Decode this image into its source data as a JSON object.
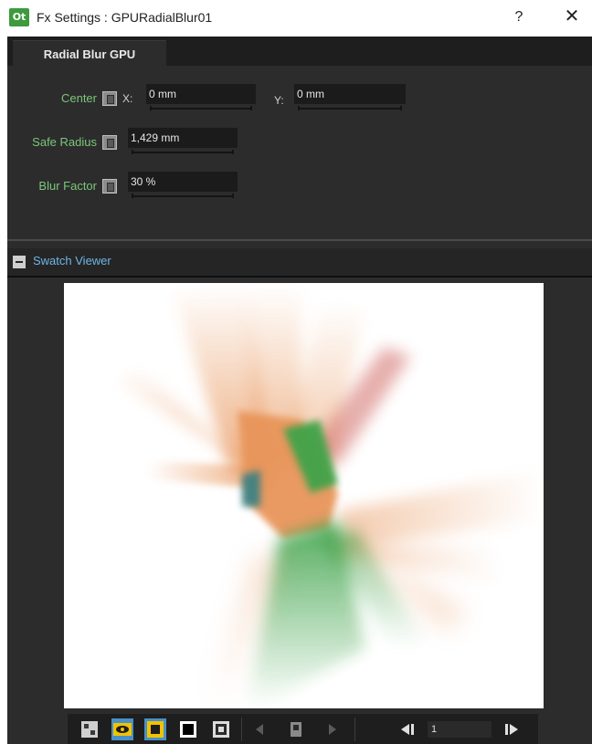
{
  "window": {
    "title": "Fx Settings : GPURadialBlur01",
    "app_icon_text": "Ot",
    "help_label": "?",
    "close_label": "✕"
  },
  "tabs": [
    {
      "label": "Radial Blur GPU",
      "active": true
    }
  ],
  "params": {
    "center": {
      "label": "Center",
      "x_label": "X:",
      "x_value": "0 mm",
      "y_label": "Y:",
      "y_value": "0 mm"
    },
    "safe_radius": {
      "label": "Safe Radius",
      "value": "1,429 mm"
    },
    "blur_factor": {
      "label": "Blur Factor",
      "value": "30 %"
    }
  },
  "swatch_viewer": {
    "title": "Swatch Viewer",
    "collapse_label": "−"
  },
  "toolbar": {
    "frame_value": "1",
    "buttons": [
      {
        "name": "preview-settings-icon",
        "active": false
      },
      {
        "name": "eye-icon",
        "active": true
      },
      {
        "name": "camera-stand-icon",
        "active": true
      },
      {
        "name": "black-bg-icon",
        "active": false
      },
      {
        "name": "checkerboard-icon",
        "active": false
      },
      {
        "name": "prev-key-icon",
        "active": false
      },
      {
        "name": "key-icon",
        "active": false
      },
      {
        "name": "next-key-icon",
        "active": false
      },
      {
        "name": "prev-frame-icon",
        "active": false
      },
      {
        "name": "next-frame-icon",
        "active": false
      }
    ]
  },
  "colors": {
    "accent_label": "#7bc67b",
    "swatch_title": "#6fb6e6",
    "active_button": "#4a90c8",
    "panel_bg": "#2c2c2c",
    "blur_orange": "#e8955a",
    "blur_green": "#3fa34a",
    "blur_red": "#c8504a",
    "blur_teal": "#2a7f86"
  }
}
